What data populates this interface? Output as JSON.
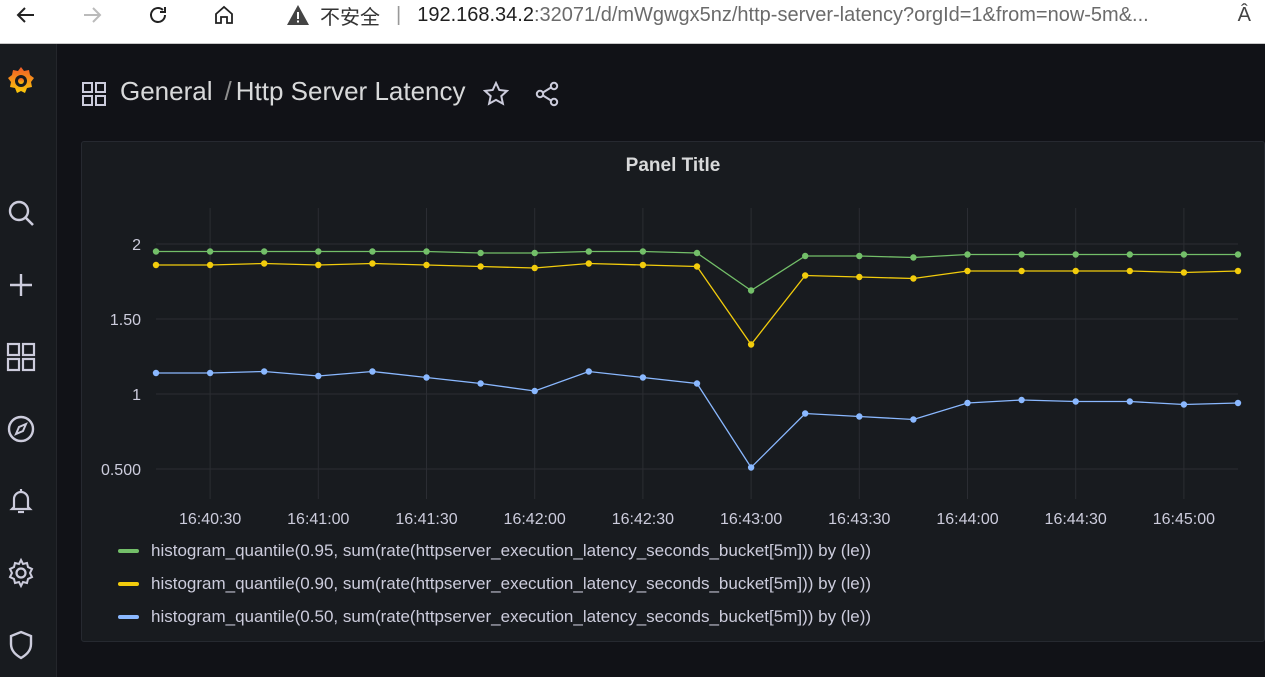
{
  "browser": {
    "insecure_label": "不安全",
    "separator": "|",
    "url_host": "192.168.34.2",
    "url_rest": ":32071/d/mWgwgx5nz/http-server-latency?orgId=1&from=now-5m&...",
    "read_aloud": "Â"
  },
  "header": {
    "folder": "General",
    "slash": "/",
    "title": "Http Server Latency"
  },
  "panel": {
    "title": "Panel Title"
  },
  "colors": {
    "series_095": "#73bf69",
    "series_090": "#f2cc0c",
    "series_050": "#8ab8ff"
  },
  "chart_data": {
    "type": "line",
    "title": "Panel Title",
    "xlabel": "",
    "ylabel": "",
    "ylim": [
      0.3,
      2.2
    ],
    "yticks": [
      {
        "value": 2,
        "label": "2"
      },
      {
        "value": 1.5,
        "label": "1.50"
      },
      {
        "value": 1,
        "label": "1"
      },
      {
        "value": 0.5,
        "label": "0.500"
      }
    ],
    "xticks": [
      "16:40:30",
      "16:41:00",
      "16:41:30",
      "16:42:00",
      "16:42:30",
      "16:43:00",
      "16:43:30",
      "16:44:00",
      "16:44:30",
      "16:45:00"
    ],
    "x": [
      "16:40:15",
      "16:40:30",
      "16:40:45",
      "16:41:00",
      "16:41:15",
      "16:41:30",
      "16:41:45",
      "16:42:00",
      "16:42:15",
      "16:42:30",
      "16:42:45",
      "16:43:00",
      "16:43:15",
      "16:43:30",
      "16:43:45",
      "16:44:00",
      "16:44:15",
      "16:44:30",
      "16:44:45",
      "16:45:00",
      "16:45:15"
    ],
    "series": [
      {
        "name": "histogram_quantile(0.95, sum(rate(httpserver_execution_latency_seconds_bucket[5m])) by (le))",
        "color": "#73bf69",
        "values": [
          1.95,
          1.95,
          1.95,
          1.95,
          1.95,
          1.95,
          1.94,
          1.94,
          1.95,
          1.95,
          1.94,
          1.69,
          1.92,
          1.92,
          1.91,
          1.93,
          1.93,
          1.93,
          1.93,
          1.93,
          1.93
        ]
      },
      {
        "name": "histogram_quantile(0.90, sum(rate(httpserver_execution_latency_seconds_bucket[5m])) by (le))",
        "color": "#f2cc0c",
        "values": [
          1.86,
          1.86,
          1.87,
          1.86,
          1.87,
          1.86,
          1.85,
          1.84,
          1.87,
          1.86,
          1.85,
          1.33,
          1.79,
          1.78,
          1.77,
          1.82,
          1.82,
          1.82,
          1.82,
          1.81,
          1.82
        ]
      },
      {
        "name": "histogram_quantile(0.50, sum(rate(httpserver_execution_latency_seconds_bucket[5m])) by (le))",
        "color": "#8ab8ff",
        "values": [
          1.14,
          1.14,
          1.15,
          1.12,
          1.15,
          1.11,
          1.07,
          1.02,
          1.15,
          1.11,
          1.07,
          0.51,
          0.87,
          0.85,
          0.83,
          0.94,
          0.96,
          0.95,
          0.95,
          0.93,
          0.94
        ]
      }
    ],
    "grid": true,
    "legend": "bottom"
  }
}
